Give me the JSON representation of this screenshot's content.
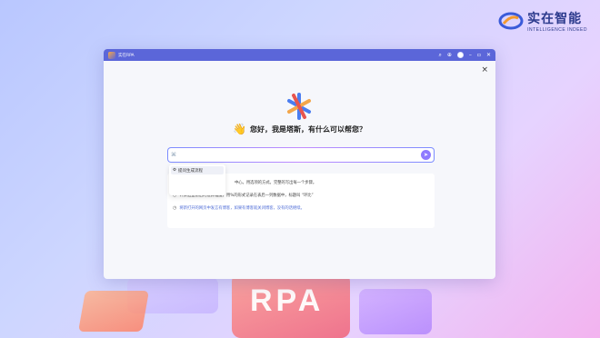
{
  "brand": {
    "name_cn": "实在智能",
    "name_en": "INTELLIGENCE INDEED"
  },
  "background": {
    "rpa_text": "RPA"
  },
  "window": {
    "title": "实在RPA",
    "icons": [
      "search-icon",
      "add-circle-icon",
      "minus-icon",
      "maximize-icon",
      "close-icon"
    ],
    "close_glyph": "×"
  },
  "main": {
    "greeting": "您好，我是塔斯，有什么可以帮您？",
    "input_placeholder": "",
    "dropdown": {
      "items": [
        {
          "label": "提问生成流程",
          "active": true
        },
        {
          "label": "",
          "active": false
        },
        {
          "label": "",
          "active": false
        }
      ]
    },
    "hints": [
      {
        "text": "中心。用选项的方式。完整的写出每一个步骤。",
        "link": false
      },
      {
        "text": "计算这些前后的差异幅度，用%的形式记录在表后一列数据中，标题叫 “环比”",
        "link": false
      },
      {
        "text": "将新打开的网页中发言有博客，如果有博客就关闭博客，没有的话继续。",
        "link": true
      }
    ]
  },
  "colors": {
    "titlebar": "#5b66d9",
    "accent": "#8f7bff",
    "link": "#4d6bd6"
  }
}
